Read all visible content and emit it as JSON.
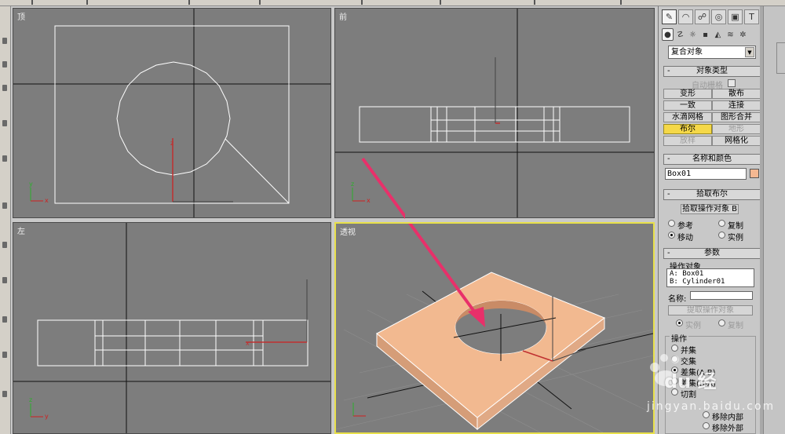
{
  "viewports": {
    "top": {
      "label": "顶"
    },
    "front": {
      "label": "前"
    },
    "left": {
      "label": "左"
    },
    "perspective": {
      "label": "透视"
    }
  },
  "axes": {
    "x": "x",
    "y": "y",
    "z": "z"
  },
  "panel": {
    "category": "复合对象",
    "object_type": {
      "header": "对象类型",
      "minus": "-",
      "autogrid": "自动栅格",
      "buttons": [
        "变形",
        "散布",
        "一致",
        "连接",
        "水滴网格",
        "图形合并",
        "布尔",
        "地形",
        "放样",
        "网格化"
      ]
    },
    "name_color": {
      "header": "名称和颜色",
      "minus": "-",
      "name": "Box01",
      "color": "#f4b892"
    },
    "pick_boolean": {
      "header": "拾取布尔",
      "minus": "-",
      "pick_button": "拾取操作对象 B",
      "options": [
        "参考",
        "复制",
        "移动",
        "实例"
      ]
    },
    "parameters": {
      "header": "参数",
      "minus": "-",
      "operands_label": "操作对象",
      "operand_a": "A: Box01",
      "operand_b": "B: Cylinder01",
      "name_label": "名称:",
      "name_value": "",
      "extract_button": "提取操作对象",
      "extract_options": [
        "实例",
        "复制"
      ],
      "operation_label": "操作",
      "operations": [
        "并集",
        "交集",
        "差集(A-B)",
        "差集(B-A)",
        "切割"
      ],
      "cut_options": [
        "移除内部",
        "移除外部"
      ]
    }
  },
  "watermark": {
    "logo": "du 经",
    "sub": "jingyan.baidu.com"
  },
  "colors": {
    "viewport_bg": "#7d7d7d",
    "active_border": "#e8e04a",
    "box_fill": "#f2b990",
    "arrow": "#e8306a"
  }
}
